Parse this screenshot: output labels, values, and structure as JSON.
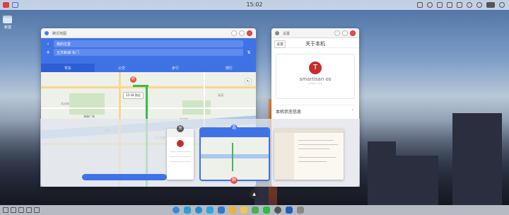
{
  "topbar": {
    "clock": "15:02",
    "left_icons": [
      "smartisan-logo-icon",
      "display-icon"
    ],
    "right_icons": [
      "screenshot-icon",
      "cloud-icon",
      "settings-icon",
      "camera-icon",
      "trash-icon",
      "bluetooth-icon",
      "wifi-icon",
      "battery-icon",
      "user-icon"
    ]
  },
  "desktop": {
    "folder_label": "新建"
  },
  "maps_window": {
    "title": "腾讯地图",
    "origin": "我的位置",
    "destination": "五羊新城-东门",
    "modes": [
      "驾车",
      "公交",
      "步行",
      "骑行"
    ],
    "active_mode": 0,
    "map_labels": [
      "大沙头",
      "海珠广场",
      "二沙岛",
      "天河",
      "沿江东路",
      "珠江",
      "海印桥"
    ],
    "route_bubble": "15:18 到达",
    "pin_label": "终"
  },
  "settings_window": {
    "title": "设置",
    "back_label": "设置",
    "header": "关于本机",
    "os_name": "smartisan os",
    "os_version": "version 7.0.0",
    "row_label": "本机状态信息"
  },
  "overview": {
    "badges": [
      "关",
      "选",
      "删"
    ]
  },
  "dock": {
    "apps": [
      {
        "name": "launcher-app-icon",
        "color": "#3a8ad8"
      },
      {
        "name": "chat-app-icon",
        "color": "#2a9fd8"
      },
      {
        "name": "browser-app-icon",
        "color": "#2a8ad0"
      },
      {
        "name": "mail-app-icon",
        "color": "#28a8e0"
      },
      {
        "name": "calendar-app-icon",
        "color": "#3478c8"
      },
      {
        "name": "notes-app-icon",
        "color": "#f0b030"
      },
      {
        "name": "folder-app-icon",
        "color": "#f2c84a"
      },
      {
        "name": "chrome-app-icon",
        "color": "#4caf50"
      },
      {
        "name": "wechat-app-icon",
        "color": "#2dbb4a"
      },
      {
        "name": "camera-app-icon",
        "color": "#555555"
      },
      {
        "name": "eye-app-icon",
        "color": "#1e5fb8"
      },
      {
        "name": "trash-app-icon",
        "color": "#888888"
      }
    ]
  }
}
